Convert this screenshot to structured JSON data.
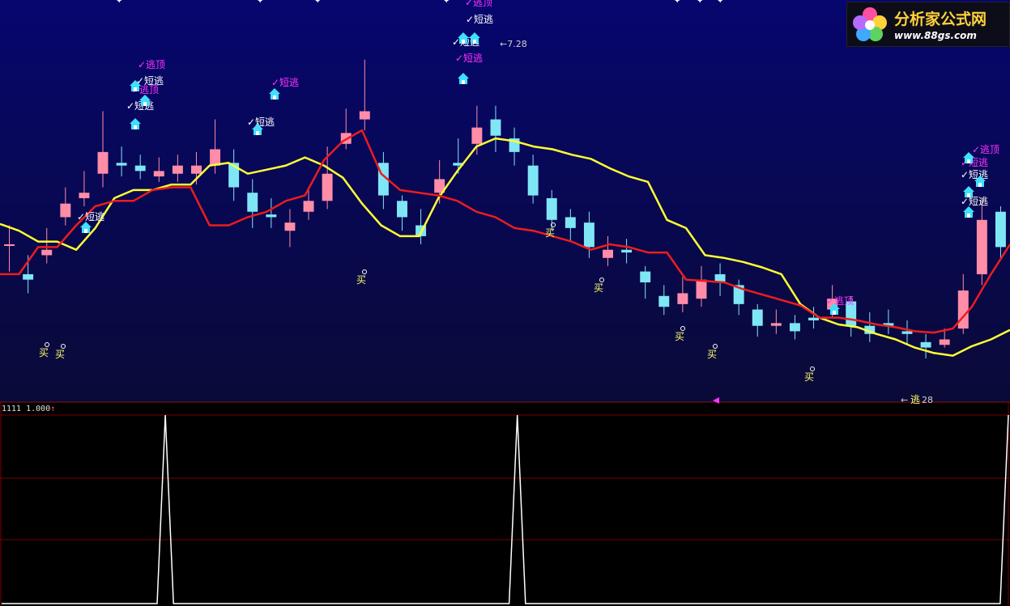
{
  "logo": {
    "title": "分析家公式网",
    "url": "www.88gs.com"
  },
  "sub_indicator": {
    "name": "1111",
    "value": "1.000",
    "arrow": "↑"
  },
  "colors": {
    "top_bg_top": "#050566",
    "top_bg_bottom": "#0a0a3a",
    "up_candle": "#ff8da8",
    "down_candle": "#7fe6f5",
    "line_yellow": "#ffff33",
    "line_red": "#ee1c1c",
    "buy_text": "#ffff66",
    "escape_text": "#ffffff",
    "top_escape_text": "#ff33ff",
    "house_icon": "#3fe0ff",
    "grid_line": "#7a0000",
    "spike_line": "#ffffff"
  },
  "chart_data": [
    {
      "type": "candlestick",
      "title": "",
      "price_labels": [
        "7.28",
        "28"
      ],
      "signals": {
        "buy": [
          "买",
          "买",
          "买",
          "买",
          "买",
          "买",
          "买",
          "买"
        ],
        "short_escape": [
          "短逃",
          "短逃",
          "短逃",
          "短逃",
          "短逃",
          "短逃",
          "短逃",
          "短逃",
          "短逃",
          "短逃",
          "短逃"
        ],
        "top_escape": [
          "逃顶",
          "逃顶",
          "逃顶",
          "逃顶",
          "逃顶"
        ],
        "bottom_escape": [
          "逃"
        ]
      },
      "series": [
        {
          "color": "#ffff33",
          "values": [
            6.35,
            6.1,
            5.7,
            5.7,
            5.4,
            6.2,
            7.3,
            7.6,
            7.6,
            7.8,
            7.8,
            8.5,
            8.6,
            8.2,
            8.35,
            8.5,
            8.8,
            8.5,
            8.05,
            7.1,
            6.3,
            5.9,
            5.9,
            7.3,
            8.3,
            9.2,
            9.5,
            9.4,
            9.2,
            9.1,
            8.9,
            8.75,
            8.4,
            8.1,
            7.9,
            6.5,
            6.2,
            5.2,
            5.1,
            4.95,
            4.75,
            4.5,
            3.4,
            2.9,
            2.65,
            2.55,
            2.3,
            2.1,
            1.8,
            1.6,
            1.5,
            1.85,
            2.1,
            2.45
          ]
        },
        {
          "color": "#ee1c1c",
          "values": [
            4.5,
            4.5,
            5.5,
            5.5,
            6.3,
            7,
            7.2,
            7.2,
            7.6,
            7.7,
            7.7,
            6.3,
            6.3,
            6.6,
            6.8,
            7.2,
            7.4,
            8.7,
            9.4,
            9.8,
            8.2,
            7.6,
            7.5,
            7.4,
            7.2,
            6.8,
            6.6,
            6.2,
            6.1,
            5.9,
            5.7,
            5.4,
            5.6,
            5.5,
            5.3,
            5.3,
            4.3,
            4.25,
            4.2,
            3.95,
            3.75,
            3.55,
            3.35,
            2.9,
            2.9,
            2.8,
            2.65,
            2.55,
            2.4,
            2.35,
            2.5,
            3.3,
            4.5,
            5.6
          ]
        }
      ],
      "candles": [
        [
          5.6,
          5.6,
          6.3,
          4.6
        ],
        [
          4.5,
          4.3,
          5.2,
          3.8
        ],
        [
          5.2,
          5.4,
          6.2,
          4.9
        ],
        [
          6.6,
          7.1,
          7.7,
          6.3
        ],
        [
          7.3,
          7.5,
          8.3,
          7
        ],
        [
          8.2,
          9,
          10.5,
          7.7
        ],
        [
          8.6,
          8.5,
          9.2,
          8.1
        ],
        [
          8.5,
          8.3,
          8.9,
          8
        ],
        [
          8.1,
          8.3,
          8.8,
          7.9
        ],
        [
          8.2,
          8.5,
          8.9,
          7.9
        ],
        [
          8.2,
          8.5,
          9,
          7.8
        ],
        [
          8.5,
          9.1,
          10.2,
          8.2
        ],
        [
          8.6,
          7.7,
          9.1,
          7.2
        ],
        [
          7.5,
          6.8,
          8,
          6.2
        ],
        [
          6.7,
          6.6,
          7.3,
          6.2
        ],
        [
          6.1,
          6.4,
          6.9,
          5.5
        ],
        [
          6.8,
          7.2,
          7.7,
          6.5
        ],
        [
          7.2,
          8.2,
          9.2,
          6.9
        ],
        [
          9.3,
          9.7,
          10.6,
          9.1
        ],
        [
          10.2,
          10.5,
          12.4,
          9.8
        ],
        [
          8.6,
          7.4,
          9,
          6.9
        ],
        [
          7.2,
          6.6,
          7.4,
          6.1
        ],
        [
          6.3,
          5.9,
          6.9,
          5.6
        ],
        [
          7.5,
          8,
          8.7,
          7.1
        ],
        [
          8.6,
          8.5,
          9.5,
          8.2
        ],
        [
          9.3,
          9.9,
          10.7,
          8.9
        ],
        [
          10.2,
          9.6,
          10.7,
          9
        ],
        [
          9.5,
          9,
          9.9,
          8.5
        ],
        [
          8.5,
          7.4,
          8.9,
          7.1
        ],
        [
          7.3,
          6.5,
          7.6,
          6.1
        ],
        [
          6.6,
          6.2,
          6.9,
          5.7
        ],
        [
          6.4,
          5.5,
          6.8,
          5.1
        ],
        [
          5.1,
          5.4,
          5.9,
          4.8
        ],
        [
          5.4,
          5.3,
          5.8,
          4.9
        ],
        [
          4.6,
          4.2,
          4.8,
          3.6
        ],
        [
          3.7,
          3.3,
          4.1,
          3
        ],
        [
          3.4,
          3.8,
          4.4,
          3.1
        ],
        [
          3.6,
          4.3,
          4.8,
          3.3
        ],
        [
          4.5,
          4.2,
          4.9,
          3.7
        ],
        [
          4.1,
          3.4,
          4.3,
          3
        ],
        [
          3.2,
          2.6,
          3.4,
          2.2
        ],
        [
          2.6,
          2.7,
          3.2,
          2.3
        ],
        [
          2.7,
          2.4,
          3,
          2.1
        ],
        [
          2.9,
          2.8,
          3.3,
          2.5
        ],
        [
          3.2,
          3.6,
          4.1,
          2.9
        ],
        [
          3.5,
          2.6,
          3.7,
          2.2
        ],
        [
          2.6,
          2.3,
          3.1,
          2
        ],
        [
          2.7,
          2.6,
          3.2,
          2.3
        ],
        [
          2.4,
          2.3,
          2.8,
          1.9
        ],
        [
          2,
          1.8,
          2.3,
          1.4
        ],
        [
          1.9,
          2.1,
          2.5,
          1.8
        ],
        [
          2.5,
          3.9,
          4.5,
          2.3
        ],
        [
          4.5,
          6.5,
          7.3,
          4.1
        ],
        [
          6.8,
          5.5,
          7,
          5.1
        ]
      ],
      "ylim": [
        0,
        14
      ]
    },
    {
      "type": "line",
      "title": "",
      "values": [
        0,
        0,
        0,
        0,
        0,
        0,
        0,
        0,
        0,
        0,
        0,
        0,
        0,
        0,
        0,
        0,
        0,
        0,
        0,
        0,
        1,
        0,
        0,
        0,
        0,
        0,
        0,
        0,
        0,
        0,
        0,
        0,
        0,
        0,
        0,
        0,
        0,
        0,
        0,
        0,
        0,
        0,
        0,
        0,
        0,
        0,
        0,
        0,
        0,
        0,
        0,
        0,
        0,
        0,
        0,
        0,
        0,
        0,
        0,
        0,
        0,
        0,
        0,
        1,
        0,
        0,
        0,
        0,
        0,
        0,
        0,
        0,
        0,
        0,
        0,
        0,
        0,
        0,
        0,
        0,
        0,
        0,
        0,
        0,
        0,
        0,
        0,
        0,
        0,
        0,
        0,
        0,
        0,
        0,
        0,
        0,
        0,
        0,
        0,
        0,
        0,
        0,
        0,
        0,
        0,
        0,
        0,
        0,
        0,
        0,
        0,
        0,
        0,
        0,
        0,
        0,
        0,
        0,
        0,
        0,
        0,
        0,
        0,
        1
      ],
      "ylim": [
        0,
        1
      ]
    }
  ]
}
